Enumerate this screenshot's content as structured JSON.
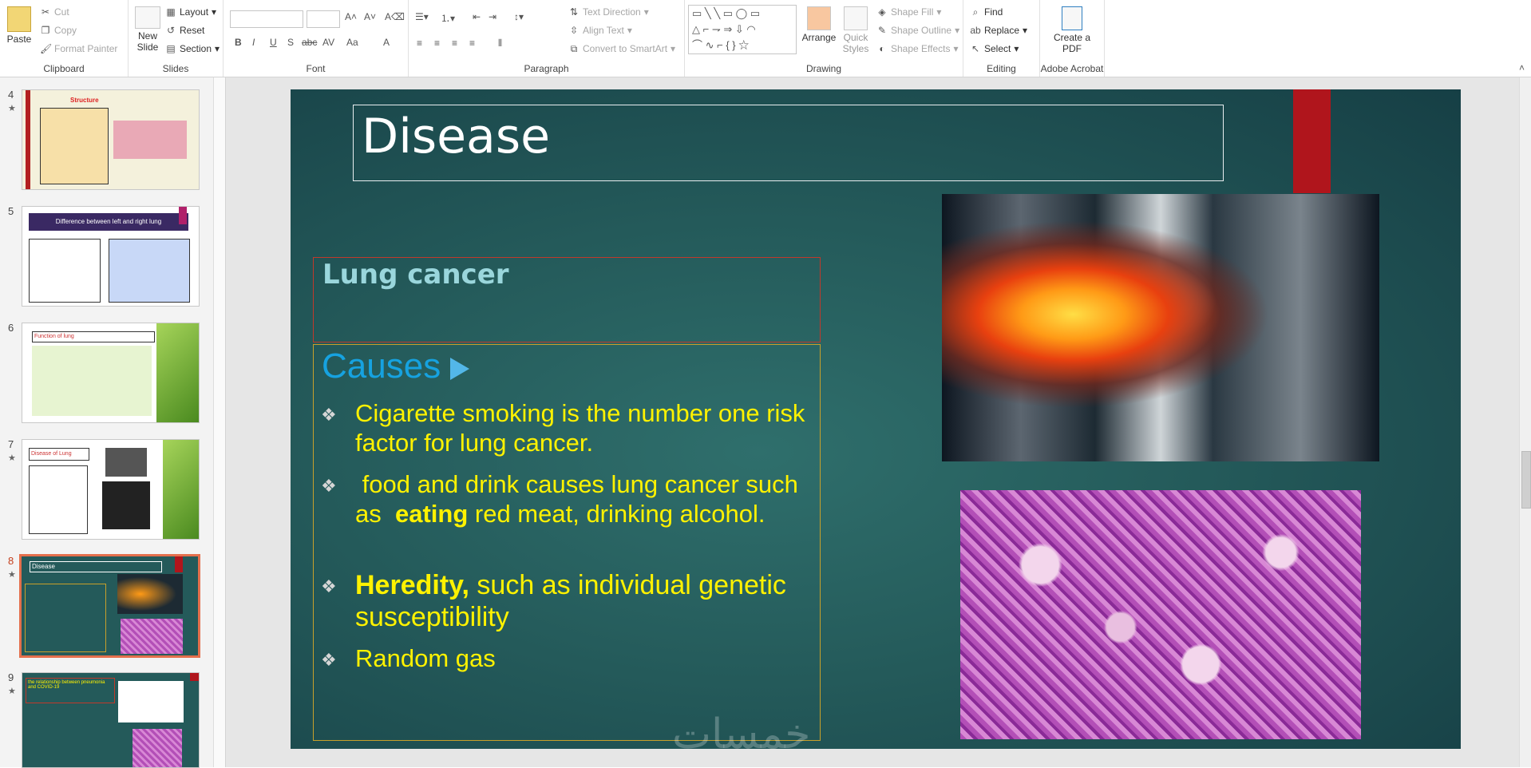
{
  "ribbon": {
    "clipboard": {
      "paste": "Paste",
      "cut": "Cut",
      "copy": "Copy",
      "format_painter": "Format Painter",
      "label": "Clipboard"
    },
    "slides": {
      "new_slide": "New Slide",
      "layout": "Layout",
      "reset": "Reset",
      "section": "Section",
      "label": "Slides"
    },
    "font": {
      "label": "Font",
      "bold": "B",
      "italic": "I",
      "underline": "U",
      "shadow": "S",
      "strike": "abc",
      "spacing": "AV",
      "case": "Aa",
      "color": "A"
    },
    "paragraph": {
      "text_direction": "Text Direction",
      "align_text": "Align Text",
      "smartart": "Convert to SmartArt",
      "label": "Paragraph"
    },
    "drawing": {
      "arrange": "Arrange",
      "quick_styles": "Quick Styles",
      "shape_fill": "Shape Fill",
      "shape_outline": "Shape Outline",
      "shape_effects": "Shape Effects",
      "label": "Drawing"
    },
    "editing": {
      "find": "Find",
      "replace": "Replace",
      "select": "Select",
      "label": "Editing"
    },
    "acrobat": {
      "create_pdf": "Create a PDF",
      "label": "Adobe Acrobat"
    }
  },
  "thumbnails": [
    {
      "num": "4",
      "title": "Structure"
    },
    {
      "num": "5",
      "title": "Difference between left and right lung"
    },
    {
      "num": "6",
      "title": "Function of lung"
    },
    {
      "num": "7",
      "title": "Disease of Lung"
    },
    {
      "num": "8",
      "title": "Disease"
    },
    {
      "num": "9",
      "title": "the relationship between pneumonia and COVID-19"
    }
  ],
  "slide": {
    "title": "Disease",
    "section_heading": "Lung cancer",
    "causes_label": "Causes",
    "bullets": [
      {
        "pre": "",
        "bold": "",
        "post": "Cigarette smoking is the number one risk factor for lung cancer."
      },
      {
        "pre": " food and drink causes lung cancer such as  ",
        "bold": "eating",
        "post": " red meat, drinking alcohol."
      },
      {
        "pre": "",
        "bold": "Heredity,",
        "post": " such as individual genetic susceptibility"
      },
      {
        "pre": "",
        "bold": "",
        "post": "Random gas"
      }
    ],
    "watermark": "خمسات"
  },
  "colors": {
    "slide_bg": "#245a5a",
    "title_red_band": "#b0151c",
    "bullet_text": "#fff200",
    "causes": "#16a2e0",
    "thumb_selected": "#e46f4c"
  }
}
